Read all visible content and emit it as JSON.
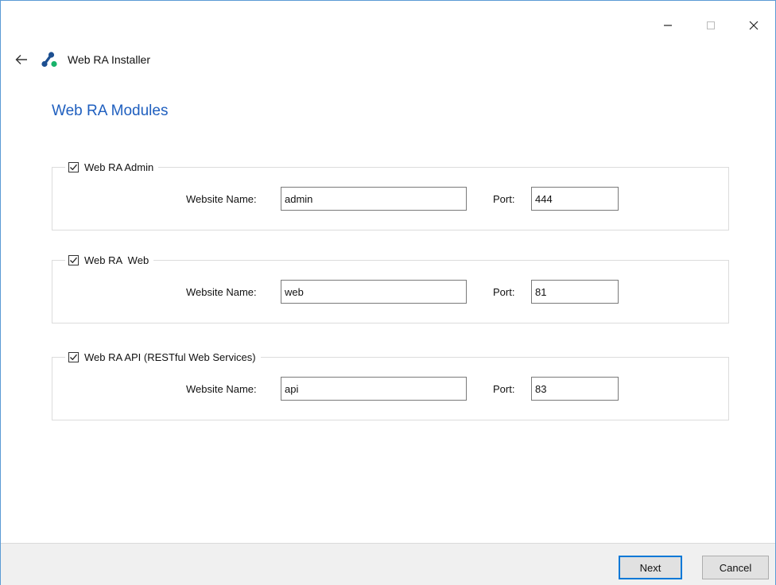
{
  "window": {
    "app_title": "Web RA Installer",
    "page_title": "Web RA Modules",
    "controls": {
      "minimize": "—",
      "maximize": "☐",
      "close": "✕"
    }
  },
  "modules": [
    {
      "label": "Web RA Admin",
      "checked": true,
      "name_label": "Website Name:",
      "name_value": "admin",
      "port_label": "Port:",
      "port_value": "444"
    },
    {
      "label": "Web RA  Web",
      "checked": true,
      "name_label": "Website Name:",
      "name_value": "web",
      "port_label": "Port:",
      "port_value": "81"
    },
    {
      "label": "Web RA API (RESTful Web Services)",
      "checked": true,
      "name_label": "Website Name:",
      "name_value": "api",
      "port_label": "Port:",
      "port_value": "83"
    }
  ],
  "footer": {
    "next_label": "Next",
    "cancel_label": "Cancel"
  },
  "colors": {
    "accent": "#0078d7",
    "title_blue": "#1f5fbf",
    "logo_blue": "#1d4f91",
    "logo_green": "#18b36b"
  }
}
